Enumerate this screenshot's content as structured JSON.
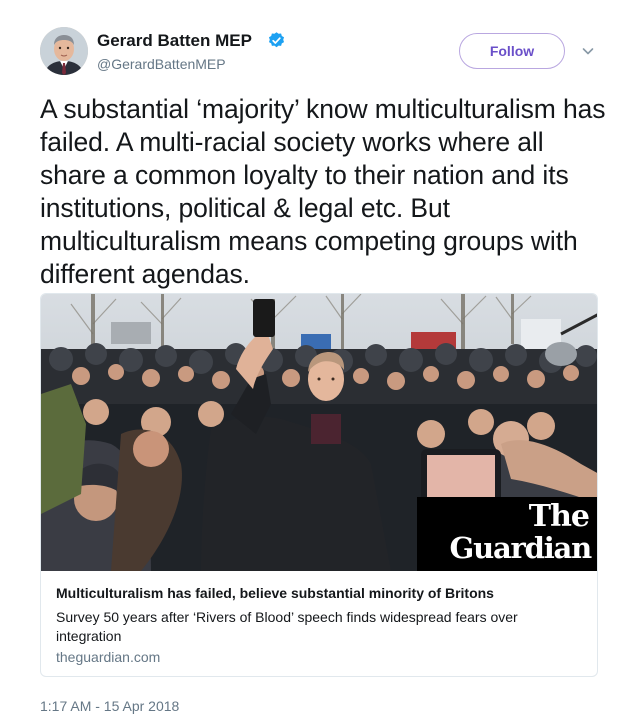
{
  "author": {
    "display_name": "Gerard Batten MEP",
    "handle": "@GerardBattenMEP",
    "verified": true,
    "avatar_icon": "profile-photo"
  },
  "follow_button": {
    "label": "Follow"
  },
  "more_menu_icon": "chevron-down-icon",
  "tweet": {
    "text": "A substantial ‘majority’ know multiculturalism has failed. A multi-racial society works where all share a common loyalty to their nation and its institutions, political & legal etc. But multiculturalism means competing groups with different agendas.",
    "timestamp": "1:17 AM - 15 Apr 2018"
  },
  "link_card": {
    "logo_line1": "The",
    "logo_line2": "Guardian",
    "title": "Multiculturalism has failed, believe substantial minority of Britons",
    "description": "Survey 50 years after ‘Rivers of Blood’ speech finds widespread fears over integration",
    "domain": "theguardian.com"
  },
  "colors": {
    "verified_badge": "#1da1f2",
    "follow_accent": "#6a4fc9",
    "secondary_text": "#657786",
    "card_border": "#e1e8ed"
  }
}
